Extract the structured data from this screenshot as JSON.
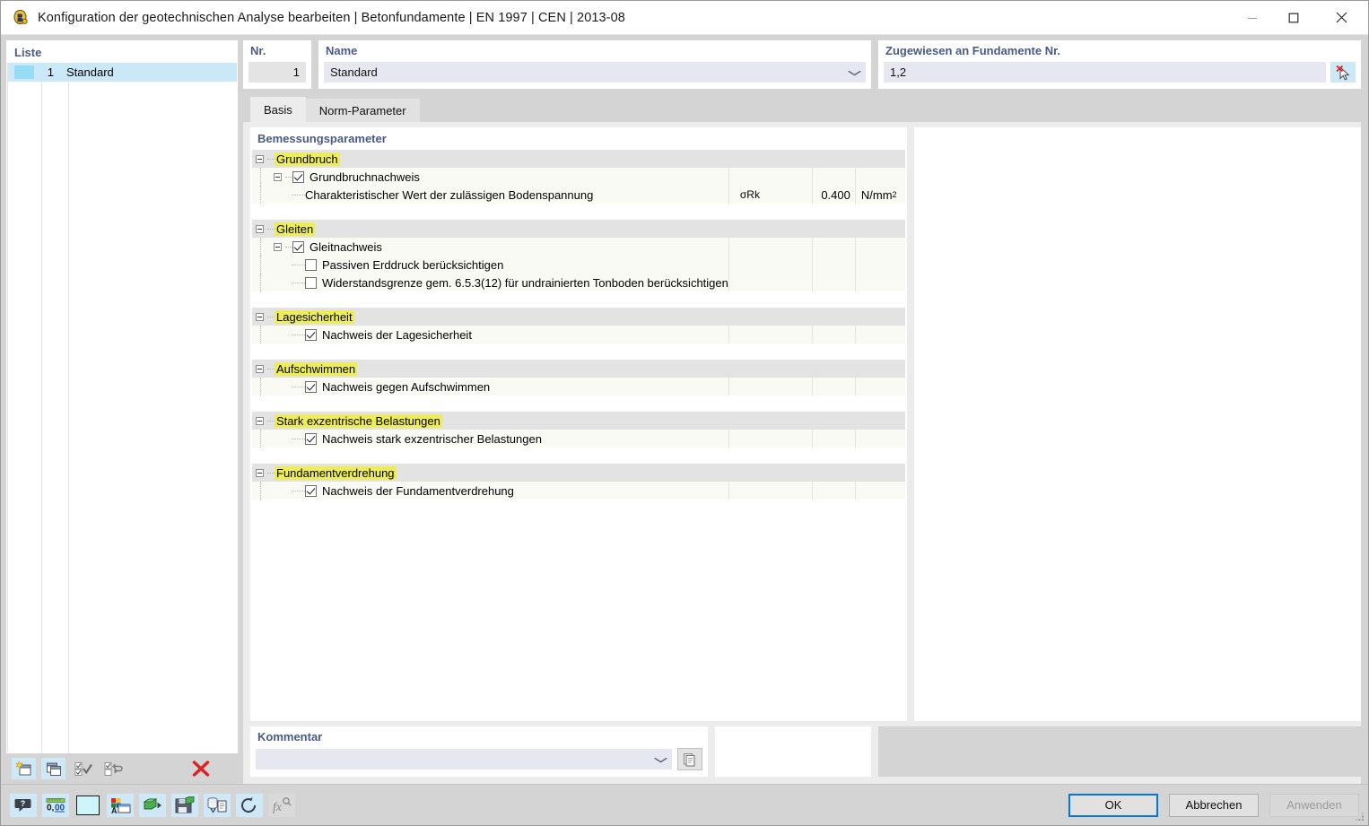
{
  "window": {
    "title": "Konfiguration der geotechnischen Analyse bearbeiten | Betonfundamente | EN 1997 | CEN | 2013-08",
    "app_icon": "dlubal-logo-icon",
    "minimize": "–",
    "maximize": "☐",
    "close": "✕"
  },
  "list_panel": {
    "label": "Liste",
    "rows": [
      {
        "number": "1",
        "name": "Standard",
        "color": "#96dcf5"
      }
    ],
    "toolbar": [
      {
        "name": "new-item-button",
        "title": "Neu"
      },
      {
        "name": "duplicate-item-button",
        "title": "Kopieren"
      },
      {
        "name": "select-all-button",
        "title": "Alle auswählen"
      },
      {
        "name": "invert-selection-button",
        "title": "Auswahl umkehren"
      },
      {
        "name": "delete-item-button",
        "title": "Löschen"
      }
    ]
  },
  "fields": {
    "nr": {
      "label": "Nr.",
      "value": "1"
    },
    "name": {
      "label": "Name",
      "value": "Standard"
    },
    "assigned": {
      "label": "Zugewiesen an Fundamente Nr.",
      "value": "1,2",
      "pick_icon": "select-objects-cursor-icon"
    }
  },
  "tabs": [
    {
      "label": "Basis",
      "active": true
    },
    {
      "label": "Norm-Parameter",
      "active": false
    }
  ],
  "tree": {
    "title": "Bemessungsparameter",
    "sections": [
      {
        "label": "Grundbruch",
        "rows": [
          {
            "kind": "check",
            "indent": 1,
            "expander": true,
            "checked": true,
            "label": "Grundbruchnachweis",
            "symbol": "",
            "value": "",
            "unit": ""
          },
          {
            "kind": "value",
            "indent": 2,
            "expander": false,
            "label": "Charakteristischer Wert der zulässigen Bodenspannung",
            "symbol": "σRk",
            "value": "0.400",
            "unit": "N/mm",
            "unit_sup": "2"
          }
        ]
      },
      {
        "label": "Gleiten",
        "rows": [
          {
            "kind": "check",
            "indent": 1,
            "expander": true,
            "checked": true,
            "label": "Gleitnachweis",
            "symbol": "",
            "value": "",
            "unit": ""
          },
          {
            "kind": "check",
            "indent": 2,
            "expander": false,
            "checked": false,
            "label": "Passiven Erddruck berücksichtigen",
            "symbol": "",
            "value": "",
            "unit": ""
          },
          {
            "kind": "check",
            "indent": 2,
            "expander": false,
            "checked": false,
            "label": "Widerstandsgrenze gem. 6.5.3(12) für undrainierten Tonboden berücksichtigen",
            "symbol": "",
            "value": "",
            "unit": ""
          }
        ]
      },
      {
        "label": "Lagesicherheit",
        "rows": [
          {
            "kind": "check",
            "indent": 2,
            "expander": false,
            "checked": true,
            "label": "Nachweis der Lagesicherheit",
            "symbol": "",
            "value": "",
            "unit": ""
          }
        ]
      },
      {
        "label": "Aufschwimmen",
        "rows": [
          {
            "kind": "check",
            "indent": 2,
            "expander": false,
            "checked": true,
            "label": "Nachweis gegen Aufschwimmen",
            "symbol": "",
            "value": "",
            "unit": ""
          }
        ]
      },
      {
        "label": "Stark exzentrische Belastungen",
        "rows": [
          {
            "kind": "check",
            "indent": 2,
            "expander": false,
            "checked": true,
            "label": "Nachweis stark exzentrischer Belastungen",
            "symbol": "",
            "value": "",
            "unit": ""
          }
        ]
      },
      {
        "label": "Fundamentverdrehung",
        "rows": [
          {
            "kind": "check",
            "indent": 2,
            "expander": false,
            "checked": true,
            "label": "Nachweis der Fundamentverdrehung",
            "symbol": "",
            "value": "",
            "unit": ""
          }
        ]
      }
    ]
  },
  "comment": {
    "label": "Kommentar",
    "value": "",
    "placeholder": "",
    "copy_icon": "copy-pages-icon"
  },
  "bottom_toolbar": [
    {
      "name": "help-button",
      "icon": "help-speech-bubble-icon",
      "state": "lit"
    },
    {
      "name": "units-button",
      "icon": "ruler-decimals-icon",
      "state": "lit"
    },
    {
      "name": "color-button",
      "icon": "color-swatch-icon",
      "state": "plain"
    },
    {
      "name": "display-properties-button",
      "icon": "display-properties-icon",
      "state": "lit"
    },
    {
      "name": "import-button",
      "icon": "import-database-icon",
      "state": "lit"
    },
    {
      "name": "export-button",
      "icon": "export-save-icon",
      "state": "lit"
    },
    {
      "name": "save-to-library-button",
      "icon": "save-library-icon",
      "state": "lit"
    },
    {
      "name": "reset-button",
      "icon": "undo-reset-icon",
      "state": "lit"
    },
    {
      "name": "formula-button",
      "icon": "formula-fx-icon",
      "state": "dim"
    }
  ],
  "dialog_buttons": {
    "ok": "OK",
    "cancel": "Abbrechen",
    "apply": "Anwenden"
  },
  "colors": {
    "accent": "#0078d7",
    "label": "#4a5a84",
    "highlight": "#ecec5c",
    "selection": "#cbe8f8",
    "field": "#e6e7f1"
  }
}
